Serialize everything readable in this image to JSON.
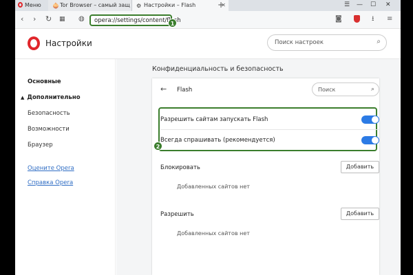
{
  "browser": {
    "menu_label": "Меню",
    "tabs": [
      {
        "label": "Tor Browser – самый защ"
      },
      {
        "label": "Настройки – Flash"
      }
    ],
    "new_tab": "+",
    "url": "opera://settings/content/flash"
  },
  "markers": {
    "one": "1",
    "two": "2"
  },
  "header": {
    "title": "Настройки",
    "search_placeholder": "Поиск настроек"
  },
  "sidebar": {
    "items": [
      {
        "label": "Основные"
      },
      {
        "label": "Дополнительно"
      },
      {
        "label": "Безопасность"
      },
      {
        "label": "Возможности"
      },
      {
        "label": "Браузер"
      }
    ],
    "links": [
      {
        "label": "Оцените Opera"
      },
      {
        "label": "Справка Opera"
      }
    ]
  },
  "main": {
    "section_title": "Конфиденциальность и безопасность",
    "card": {
      "title": "Flash",
      "search_placeholder": "Поиск",
      "toggles": [
        {
          "label": "Разрешить сайтам запускать Flash",
          "on": true
        },
        {
          "label": "Всегда спрашивать (рекомендуется)",
          "on": true
        }
      ],
      "block": {
        "label": "Блокировать",
        "button": "Добавить",
        "empty": "Добавленных сайтов нет"
      },
      "allow": {
        "label": "Разрешить",
        "button": "Добавить",
        "empty": "Добавленных сайтов нет"
      }
    }
  },
  "colors": {
    "accent": "#2c7be5",
    "highlight": "#3a7d2c",
    "brand": "#e0262b"
  }
}
